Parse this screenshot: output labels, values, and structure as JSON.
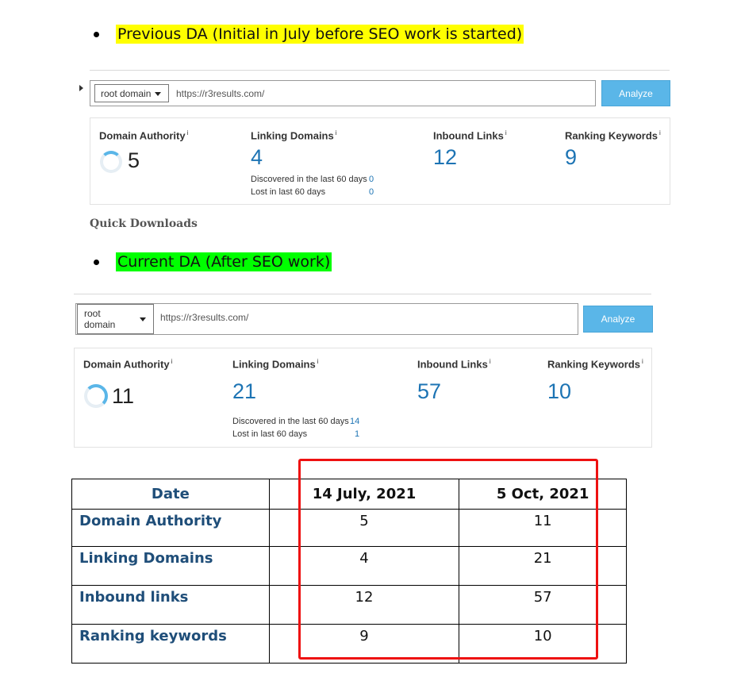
{
  "bullets": {
    "previous": "Previous DA (Initial in July before SEO work is started)",
    "current": "Current DA (After SEO work)"
  },
  "panel_previous": {
    "select_value": "root domain",
    "url": "https://r3results.com/",
    "analyze_label": "Analyze",
    "domain_authority": {
      "label": "Domain Authority",
      "info": "i",
      "value": "5"
    },
    "linking_domains": {
      "label": "Linking Domains",
      "info": "i",
      "value": "4",
      "discovered_label": "Discovered in the last 60 days",
      "discovered_value": "0",
      "lost_label": "Lost in last 60 days",
      "lost_value": "0"
    },
    "inbound_links": {
      "label": "Inbound Links",
      "info": "i",
      "value": "12"
    },
    "ranking_keywords": {
      "label": "Ranking Keywords",
      "info": "i",
      "value": "9"
    }
  },
  "quick_downloads": "Quick Downloads",
  "panel_current": {
    "select_value_line1": "root",
    "select_value_line2": "domain",
    "url": "https://r3results.com/",
    "analyze_label": "Analyze",
    "domain_authority": {
      "label": "Domain Authority",
      "info": "i",
      "value": "11"
    },
    "linking_domains": {
      "label": "Linking Domains",
      "info": "i",
      "value": "21",
      "discovered_label": "Discovered in the last 60 days",
      "discovered_value": "14",
      "lost_label": "Lost in last 60 days",
      "lost_value": "1"
    },
    "inbound_links": {
      "label": "Inbound Links",
      "info": "i",
      "value": "57"
    },
    "ranking_keywords": {
      "label": "Ranking Keywords",
      "info": "i",
      "value": "10"
    }
  },
  "table": {
    "headers": [
      "Date",
      "14 July, 2021",
      "5 Oct, 2021"
    ],
    "rows": [
      {
        "label": "Domain Authority",
        "v1": "5",
        "v2": "11"
      },
      {
        "label": "Linking Domains",
        "v1": "4",
        "v2": "21"
      },
      {
        "label": "Inbound links",
        "v1": "12",
        "v2": "57"
      },
      {
        "label": "Ranking keywords",
        "v1": "9",
        "v2": "10"
      }
    ]
  },
  "colors": {
    "highlight_yellow": "#ffff00",
    "highlight_green": "#00ff00",
    "accent_blue": "#1d74b4",
    "button_blue": "#5ab6e8",
    "red_box": "#ee1111"
  }
}
